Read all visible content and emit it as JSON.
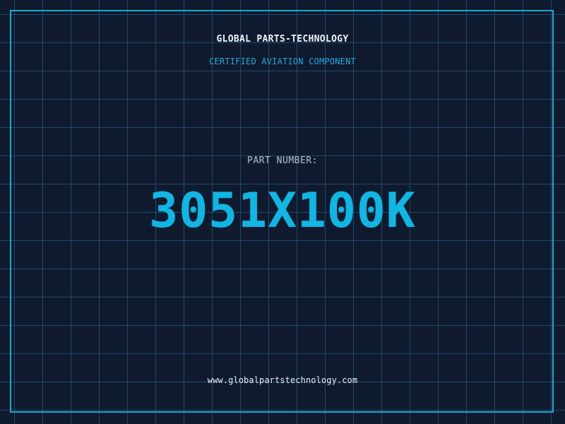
{
  "card": {
    "company": "GLOBAL PARTS-TECHNOLOGY",
    "tagline": "CERTIFIED AVIATION COMPONENT",
    "part_label": "PART NUMBER:",
    "part_number": "3051X100K",
    "website": "www.globalpartstechnology.com"
  },
  "colors": {
    "background": "#101a2e",
    "accent": "#21a7d3",
    "part_number": "#13b5e2",
    "text": "#eef4fb"
  }
}
